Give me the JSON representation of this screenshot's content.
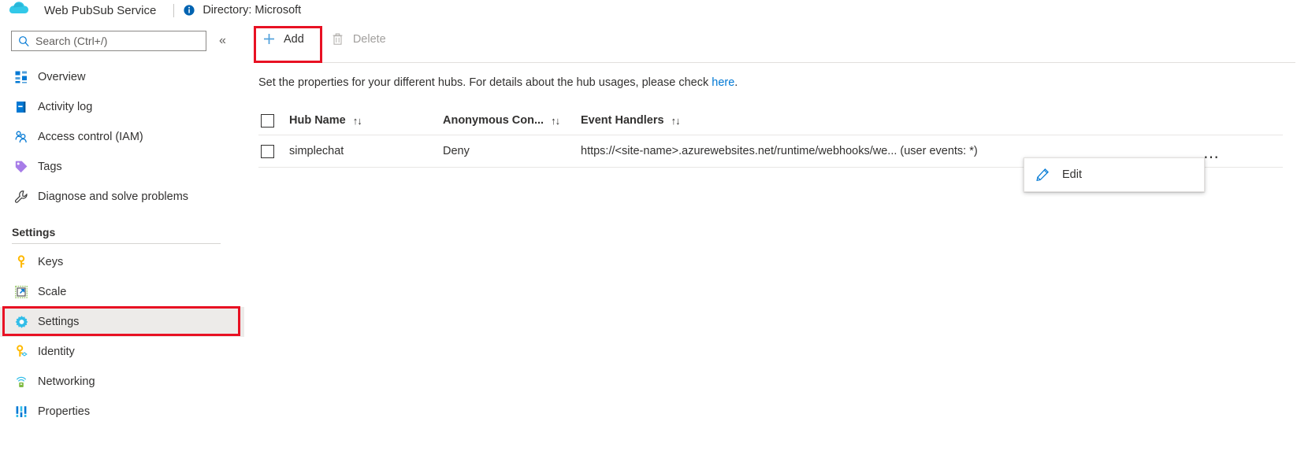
{
  "topbar": {
    "logo_icon": "web-pubsub-cloud-logo",
    "service_title": "Web PubSub Service",
    "info_icon": "info-circle-icon",
    "directory_text": "Directory: Microsoft"
  },
  "sidebar": {
    "search": {
      "icon": "search-icon",
      "placeholder": "Search (Ctrl+/)",
      "value": ""
    },
    "collapse_icon": "chevron-double-left-icon",
    "items": [
      {
        "label": "Overview",
        "icon": "overview-grid-icon",
        "selected": false
      },
      {
        "label": "Activity log",
        "icon": "activity-log-icon",
        "selected": false
      },
      {
        "label": "Access control (IAM)",
        "icon": "access-control-people-icon",
        "selected": false
      },
      {
        "label": "Tags",
        "icon": "tag-icon",
        "selected": false
      },
      {
        "label": "Diagnose and solve problems",
        "icon": "wrench-icon",
        "selected": false
      }
    ],
    "section_title": "Settings",
    "settings_items": [
      {
        "label": "Keys",
        "icon": "key-icon",
        "selected": false
      },
      {
        "label": "Scale",
        "icon": "scale-arrow-icon",
        "selected": false
      },
      {
        "label": "Settings",
        "icon": "gear-icon",
        "selected": true
      },
      {
        "label": "Identity",
        "icon": "identity-key-icon",
        "selected": false
      },
      {
        "label": "Networking",
        "icon": "networking-icon",
        "selected": false
      },
      {
        "label": "Properties",
        "icon": "properties-bars-icon",
        "selected": false
      }
    ]
  },
  "toolbar": {
    "add_label": "Add",
    "add_icon": "plus-icon",
    "delete_label": "Delete",
    "delete_icon": "trash-icon",
    "delete_disabled": true
  },
  "description": {
    "text_before": "Set the properties for your different hubs. For details about the hub usages, please check ",
    "link_text": "here",
    "text_after": "."
  },
  "table": {
    "columns": [
      {
        "title": "Hub Name",
        "sort_glyph": "↑↓"
      },
      {
        "title": "Anonymous Con...",
        "sort_glyph": "↑↓"
      },
      {
        "title": "Event Handlers",
        "sort_glyph": "↑↓"
      }
    ],
    "rows": [
      {
        "checked": false,
        "hub_name": "simplechat",
        "anonymous_connect": "Deny",
        "event_handlers": "https://<site-name>.azurewebsites.net/runtime/webhooks/we... (user events: *)"
      }
    ],
    "row_menu_icon": "ellipsis-horizontal-icon"
  },
  "context_menu": {
    "items": [
      {
        "label": "Edit",
        "icon": "pencil-edit-icon"
      }
    ]
  },
  "annotations": {
    "highlight_color": "#e81123",
    "boxes": [
      "add-button",
      "sidebar-item-settings"
    ]
  }
}
